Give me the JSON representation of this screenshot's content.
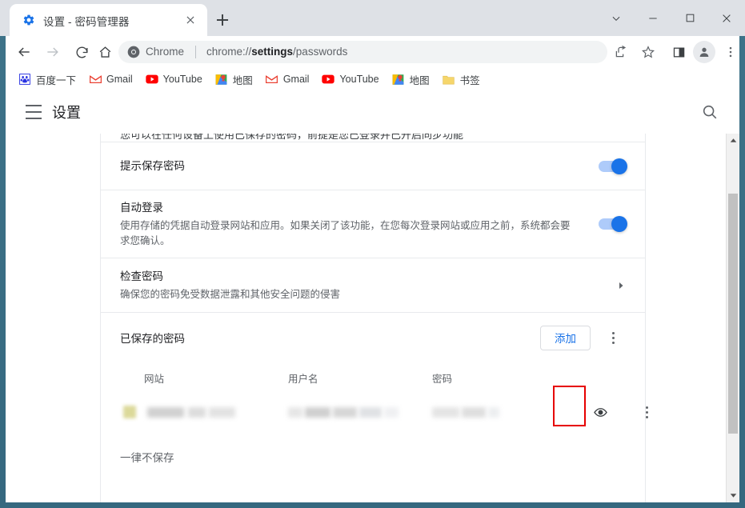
{
  "window": {
    "controls": [
      {
        "name": "tab-search",
        "glyph": "chevron-down"
      },
      {
        "name": "minimize",
        "glyph": "minimize"
      },
      {
        "name": "maximize",
        "glyph": "maximize"
      },
      {
        "name": "close",
        "glyph": "close"
      }
    ]
  },
  "tab": {
    "title": "设置 - 密码管理器",
    "favicon": "gear-icon",
    "close_label": "×",
    "newtab_label": "+"
  },
  "toolbar": {
    "back": "back-arrow-icon",
    "forward": "forward-arrow-icon",
    "reload": "reload-icon",
    "home": "home-icon",
    "omnibox": {
      "scheme_label": "Chrome",
      "url_prefix": "chrome://",
      "url_bold": "settings",
      "url_suffix": "/passwords",
      "full_url": "chrome://settings/passwords"
    },
    "icons": [
      "share-icon",
      "star-icon",
      "side-panel-icon",
      "profile-avatar-icon",
      "browser-menu-icon"
    ]
  },
  "bookmarks": [
    {
      "label": "百度一下",
      "icon": "baidu-icon"
    },
    {
      "label": "Gmail",
      "icon": "gmail-icon"
    },
    {
      "label": "YouTube",
      "icon": "youtube-icon"
    },
    {
      "label": "地图",
      "icon": "maps-icon"
    },
    {
      "label": "Gmail",
      "icon": "gmail-icon"
    },
    {
      "label": "YouTube",
      "icon": "youtube-icon"
    },
    {
      "label": "地图",
      "icon": "maps-icon"
    },
    {
      "label": "书签",
      "icon": "folder-icon"
    }
  ],
  "settings": {
    "title": "设置",
    "menu_icon": "hamburger-icon",
    "search_icon": "search-icon"
  },
  "rows": {
    "prompt_save": {
      "title": "提示保存密码",
      "toggle_on": true
    },
    "auto_signin": {
      "title": "自动登录",
      "subtitle": "使用存储的凭据自动登录网站和应用。如果关闭了该功能，在您每次登录网站或应用之前，系统都会要求您确认。",
      "toggle_on": true
    },
    "check_passwords": {
      "title": "检查密码",
      "subtitle": "确保您的密码免受数据泄露和其他安全问题的侵害",
      "chevron": "chevron-right-icon"
    }
  },
  "saved": {
    "label": "已保存的密码",
    "add_button": "添加",
    "more_icon": "more-vertical-icon",
    "columns": [
      "网站",
      "用户名",
      "密码"
    ],
    "rows": [
      {
        "site_redacted": true,
        "username_redacted": true,
        "password_redacted": true,
        "show_password_icon": "eye-icon",
        "row_menu_icon": "more-vertical-icon",
        "highlighted": true
      }
    ]
  },
  "never_saved": {
    "label": "一律不保存"
  },
  "scrollbar": {
    "up_icon": "scroll-up-arrow-icon",
    "down_icon": "scroll-down-arrow-icon"
  },
  "colors": {
    "accent_blue": "#1a73e8",
    "toggle_track": "#aecbfa",
    "highlight_red": "#e60000",
    "frame_teal": "#37718a"
  }
}
